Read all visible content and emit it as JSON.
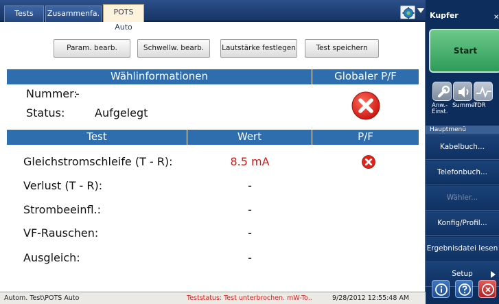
{
  "tabs": [
    "Tests",
    "Zusammenfa.",
    "POTS Auto"
  ],
  "toolbar": {
    "param": "Param. bearb.",
    "schwell": "Schwellw. bearb.",
    "lautstaerke": "Lautstärke festlegen",
    "save": "Test speichern"
  },
  "dial_info": {
    "header": "Wählinformationen",
    "global_header": "Globaler P/F",
    "number_label": "Nummer:",
    "number_value": "-",
    "status_label": "Status:",
    "status_value": "Aufgelegt",
    "global_result": "fail"
  },
  "results": {
    "headers": {
      "test": "Test",
      "value": "Wert",
      "pf": "P/F"
    },
    "rows": [
      {
        "label": "Gleichstromschleife (T - R):",
        "value": "8.5 mA",
        "pf": "fail"
      },
      {
        "label": "Verlust (T - R):",
        "value": "-",
        "pf": ""
      },
      {
        "label": "Strombeeinfl.:",
        "value": "-",
        "pf": ""
      },
      {
        "label": "VF-Rauschen:",
        "value": "-",
        "pf": ""
      },
      {
        "label": "Ausgleich:",
        "value": "-",
        "pf": ""
      }
    ]
  },
  "statusbar": {
    "path": "Autom. Test\\POTS Auto",
    "status": "Teststatus: Test unterbrochen. mW-To..",
    "datetime": "9/28/2012 12:55:48 AM"
  },
  "right_panel": {
    "title": "Kupfer",
    "start": "Start",
    "tools": [
      {
        "label": "Anw.-\nEinst.",
        "icon": "wrench-icon"
      },
      {
        "label": "Summer",
        "icon": "speaker-icon"
      },
      {
        "label": "TDR",
        "icon": "waveform-icon"
      }
    ],
    "section_label": "Hauptmenü",
    "menu": [
      {
        "label": "Kabelbuch...",
        "enabled": true
      },
      {
        "label": "Telefonbuch...",
        "enabled": true
      },
      {
        "label": "Wähler...",
        "enabled": false
      },
      {
        "label": "Konfig/Profil...",
        "enabled": true
      },
      {
        "label": "Ergebnisdatei lesen",
        "enabled": true
      },
      {
        "label": "Setup",
        "enabled": true
      }
    ]
  },
  "colors": {
    "header_blue": "#2f6eae",
    "panel_navy": "#0d2e5c",
    "start_green": "#2e9b59",
    "fail_red": "#d81616"
  }
}
